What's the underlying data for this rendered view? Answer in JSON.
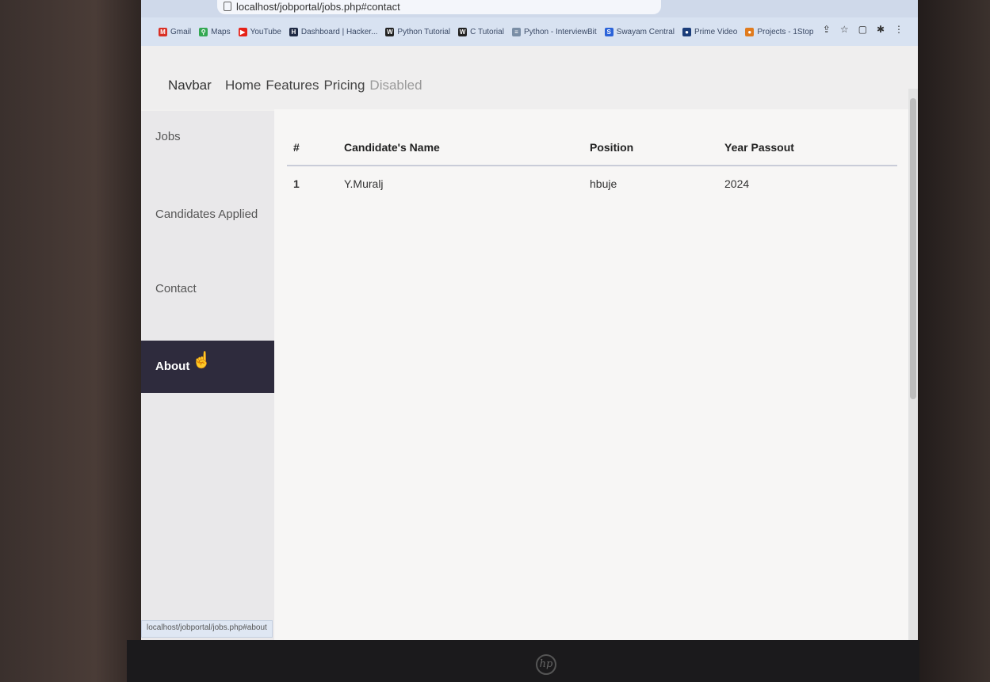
{
  "browser": {
    "address": "localhost/jobportal/jobs.php#contact",
    "bookmarks": [
      {
        "label": "Gmail",
        "icon": "gmail-icon",
        "color": "#d93025",
        "glyph": "M"
      },
      {
        "label": "Maps",
        "icon": "maps-icon",
        "color": "#34a853",
        "glyph": "⚲"
      },
      {
        "label": "YouTube",
        "icon": "youtube-icon",
        "color": "#e62117",
        "glyph": "▶"
      },
      {
        "label": "Dashboard | Hacker...",
        "icon": "hackerrank-icon",
        "color": "#1f2a44",
        "glyph": "H"
      },
      {
        "label": "Python Tutorial",
        "icon": "w3schools-icon",
        "color": "#222222",
        "glyph": "W"
      },
      {
        "label": "C Tutorial",
        "icon": "w3schools-icon",
        "color": "#222222",
        "glyph": "W"
      },
      {
        "label": "Python - InterviewBit",
        "icon": "interviewbit-icon",
        "color": "#7a8ea6",
        "glyph": "≡"
      },
      {
        "label": "Swayam Central",
        "icon": "swayam-icon",
        "color": "#2b63d9",
        "glyph": "S"
      },
      {
        "label": "Prime Video",
        "icon": "primevideo-icon",
        "color": "#1b3d7a",
        "glyph": "●"
      },
      {
        "label": "Projects - 1Stop",
        "icon": "onestop-icon",
        "color": "#e07b1e",
        "glyph": "●"
      }
    ],
    "status_url": "localhost/jobportal/jobs.php#about"
  },
  "navbar": {
    "brand": "Navbar",
    "links": [
      {
        "label": "Home",
        "disabled": false
      },
      {
        "label": "Features",
        "disabled": false
      },
      {
        "label": "Pricing",
        "disabled": false
      },
      {
        "label": "Disabled",
        "disabled": true
      }
    ]
  },
  "sidebar": {
    "items": [
      {
        "label": "Jobs",
        "active": false
      },
      {
        "label": "Candidates Applied",
        "active": false
      },
      {
        "label": "Contact",
        "active": false
      },
      {
        "label": "About",
        "active": true
      }
    ]
  },
  "table": {
    "headers": [
      "#",
      "Candidate's Name",
      "Position",
      "Year Passout"
    ],
    "rows": [
      [
        "1",
        "Y.Muralj",
        "hbuje",
        "2024"
      ]
    ]
  },
  "colors": {
    "sidebar_active_bg": "#2e2b3d",
    "bookmarks_bar_bg": "#d8e2f1"
  }
}
